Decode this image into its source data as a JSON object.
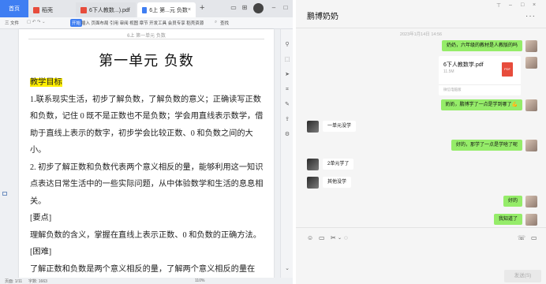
{
  "wps": {
    "tabs": {
      "home": "首页",
      "t1": "稻壳",
      "t2": "6下人教数...).pdf",
      "t3": "6上 第...元 负数"
    },
    "toolbar": {
      "file": "三 文件",
      "start": "开始",
      "items": "插入 页面布局 引用 审阅 视图 章节 开发工具 会员专享 稻壳资源",
      "search": "查找"
    },
    "running_header": "6上 第一单元 负数",
    "doc_title": "第一单元  负数",
    "section_heading": "教学目标",
    "p1": "1.联系现实生活，初步了解负数，了解负数的意义；正确读写正数和负数，记住 0 既不是正数也不是负数；学会用直线表示数学，借助于直线上表示的数字，初步学会比较正数、0 和负数之间的大小。",
    "p2": "2. 初步了解正数和负数代表两个意义相反的量，能够利用这一知识点表达日常生活中的一些实际问题，从中体验数学和生活的息息相关。",
    "key_label": "[要点]",
    "key_text": "理解负数的含义，掌握在直线上表示正数、0 和负数的正确方法。",
    "hard_label": "[困难]",
    "hard_text": "了解正数和负数是两个意义相反的量，了解两个意义相反的量在",
    "status": {
      "page": "页面: 1/11",
      "words": "字数: 1663",
      "zoom": "110%"
    }
  },
  "chat": {
    "title": "鹏博奶奶",
    "timestamp": "2023年1月14日 14:56",
    "messages": [
      {
        "from": "me",
        "text": "奶奶，六年级的教材是人教版的吗"
      },
      {
        "from": "me",
        "text": "奶奶，鹏博学了一点是学到哪了💪"
      },
      {
        "from": "other",
        "text": "一单元没学"
      },
      {
        "from": "me",
        "text": "好的，那学了一点是学啥了呢"
      },
      {
        "from": "other",
        "text": "2单元学了"
      },
      {
        "from": "other",
        "text": "其他没学"
      },
      {
        "from": "me",
        "text": "好的"
      },
      {
        "from": "me",
        "text": "我知道了"
      }
    ],
    "file": {
      "name": "6下人教数学.pdf",
      "size": "11.5M",
      "source": "微信电脑版",
      "badge": "PDF"
    },
    "send_label": "发送(S)"
  },
  "colors": {
    "accent": "#3f7ef2",
    "bubble_me": "#95ec69",
    "highlight": "#ffee00",
    "pdf": "#e74c3c"
  }
}
